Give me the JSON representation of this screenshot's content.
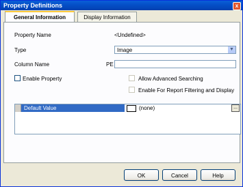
{
  "window": {
    "title": "Property Definitions",
    "close_glyph": "x"
  },
  "tabs": [
    {
      "label": "General Information",
      "active": true
    },
    {
      "label": "Display Information",
      "active": false
    }
  ],
  "form": {
    "property_name_label": "Property Name",
    "property_name_value": "<Undefined>",
    "type_label": "Type",
    "type_value": "Image",
    "column_name_label": "Column Name",
    "column_prefix": "PE",
    "column_name_value": "",
    "enable_property_label": "Enable Property",
    "allow_advanced_label": "Allow Advanced Searching",
    "enable_report_label": "Enable For Report Filtering and Display"
  },
  "grid": {
    "row_name": "Default Value",
    "row_value": "(none)",
    "ellipsis": "..."
  },
  "buttons": {
    "ok": "OK",
    "cancel": "Cancel",
    "help": "Help"
  }
}
